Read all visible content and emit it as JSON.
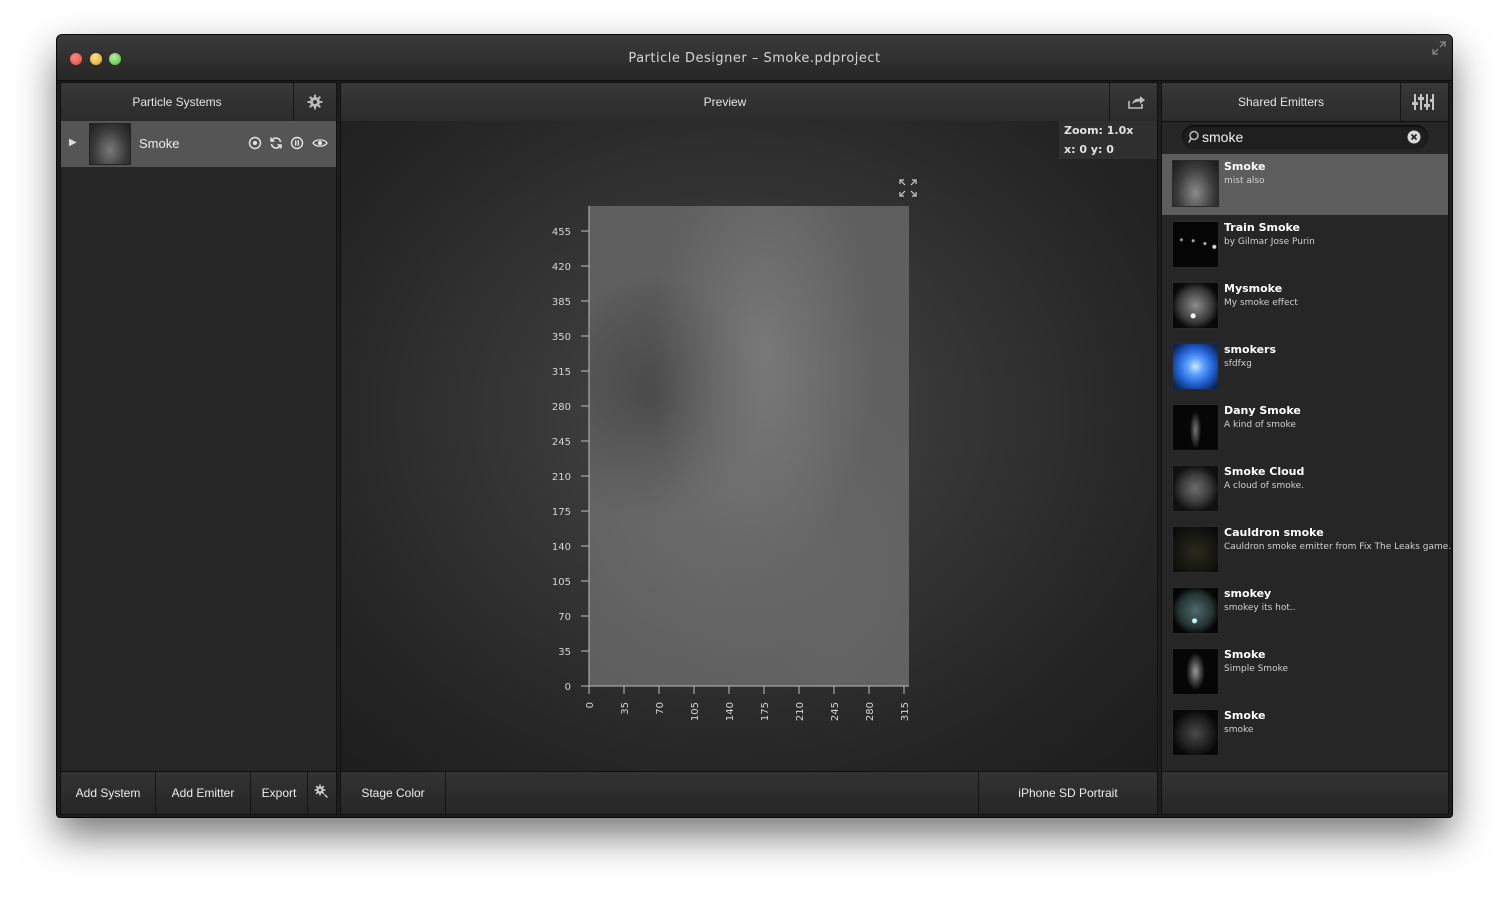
{
  "window": {
    "title": "Particle Designer – Smoke.pdproject"
  },
  "left_panel": {
    "header": "Particle Systems",
    "settings_icon": "gear-icon",
    "systems": [
      {
        "name": "Smoke",
        "expanded": false,
        "controls": [
          "target-icon",
          "refresh-icon",
          "pause-icon",
          "eye-icon"
        ]
      }
    ],
    "footer": {
      "add_system": "Add System",
      "add_emitter": "Add Emitter",
      "export": "Export",
      "settings_icon": "gear-small-icon"
    }
  },
  "center_panel": {
    "header": "Preview",
    "share_icon": "share-icon",
    "zoom_label": "Zoom: 1.0x",
    "coords_label": "x: 0 y: 0",
    "y_ticks": [
      "455",
      "420",
      "385",
      "350",
      "315",
      "280",
      "245",
      "210",
      "175",
      "140",
      "105",
      "70",
      "35",
      "0"
    ],
    "x_ticks": [
      "0",
      "35",
      "70",
      "105",
      "140",
      "175",
      "210",
      "245",
      "280",
      "315"
    ],
    "footer": {
      "stage_color": "Stage Color",
      "device": "iPhone SD Portrait"
    }
  },
  "right_panel": {
    "header": "Shared Emitters",
    "filter_icon": "sliders-icon",
    "search": {
      "value": "smoke",
      "placeholder": ""
    },
    "emitters": [
      {
        "title": "Smoke",
        "desc": "mist also",
        "selected": true
      },
      {
        "title": "Train Smoke",
        "desc": "by Gilmar Jose Purin",
        "selected": false
      },
      {
        "title": "Mysmoke",
        "desc": "My smoke effect",
        "selected": false
      },
      {
        "title": "smokers",
        "desc": "sfdfxg",
        "selected": false
      },
      {
        "title": "Dany Smoke",
        "desc": "A kind of smoke",
        "selected": false
      },
      {
        "title": "Smoke Cloud",
        "desc": "A cloud of smoke.",
        "selected": false
      },
      {
        "title": "Cauldron smoke",
        "desc": "Cauldron smoke emitter from Fix The Leaks game.",
        "selected": false
      },
      {
        "title": "smokey",
        "desc": "smokey its hot..",
        "selected": false
      },
      {
        "title": "Smoke",
        "desc": "Simple Smoke",
        "selected": false
      },
      {
        "title": "Smoke",
        "desc": "smoke",
        "selected": false
      }
    ]
  }
}
